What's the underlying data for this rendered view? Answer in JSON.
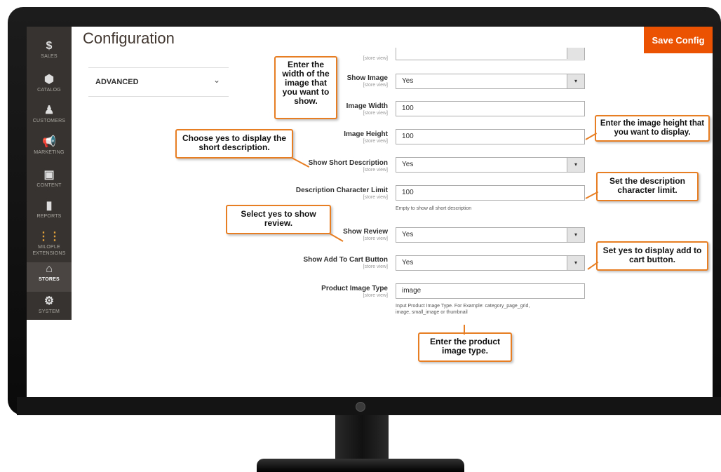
{
  "sidebar": {
    "items": [
      {
        "icon": "$",
        "label": "SALES"
      },
      {
        "icon": "⬢",
        "label": "CATALOG"
      },
      {
        "icon": "♟",
        "label": "CUSTOMERS"
      },
      {
        "icon": "📢",
        "label": "MARKETING"
      },
      {
        "icon": "▣",
        "label": "CONTENT"
      },
      {
        "icon": "▮",
        "label": "REPORTS"
      },
      {
        "icon": "⋮⋮",
        "label": "MILOPLE EXTENSIONS"
      },
      {
        "icon": "⌂",
        "label": "STORES"
      },
      {
        "icon": "⚙",
        "label": "SYSTEM"
      }
    ],
    "active_color": "#ffffff"
  },
  "header": {
    "title": "Configuration",
    "save_label": "Save Config"
  },
  "config_menu": {
    "advanced_label": "ADVANCED",
    "chevron": "⌄"
  },
  "form": {
    "show_image": {
      "label": "Show Image",
      "scope": "[store view]",
      "value": "Yes"
    },
    "image_width": {
      "label": "Image Width",
      "scope": "[store view]",
      "value": "100"
    },
    "image_height": {
      "label": "Image Height",
      "scope": "[store view]",
      "value": "100"
    },
    "show_short_description": {
      "label": "Show Short Description",
      "scope": "[store view]",
      "value": "Yes"
    },
    "description_limit": {
      "label": "Description Character Limit",
      "scope": "[store view]",
      "value": "100",
      "note": "Empty to show all short description"
    },
    "show_review": {
      "label": "Show Review",
      "scope": "[store view]",
      "value": "Yes"
    },
    "show_add_to_cart": {
      "label": "Show Add To Cart Button",
      "scope": "[store view]",
      "value": "Yes"
    },
    "product_image_type": {
      "label": "Product Image Type",
      "scope": "[store view]",
      "value": "image",
      "note_line1": "Input Product Image Type. For Example: category_page_grid,",
      "note_line2": "image, small_image or thumbnail"
    },
    "top_cut_scope": "[store view]",
    "select_arrow": "▾"
  },
  "callouts": {
    "image_width": "Enter the width of the image that you want to show.",
    "short_description": "Choose yes to display the short description.",
    "review": "Select yes to show review.",
    "image_height": "Enter the image height that you want to display.",
    "char_limit": "Set the description character limit.",
    "add_to_cart": "Set yes to display add to cart button.",
    "image_type": "Enter the product image type."
  },
  "colors": {
    "accent": "#eb5202",
    "callout_border": "#e87e23",
    "sidebar_bg": "#373330"
  }
}
